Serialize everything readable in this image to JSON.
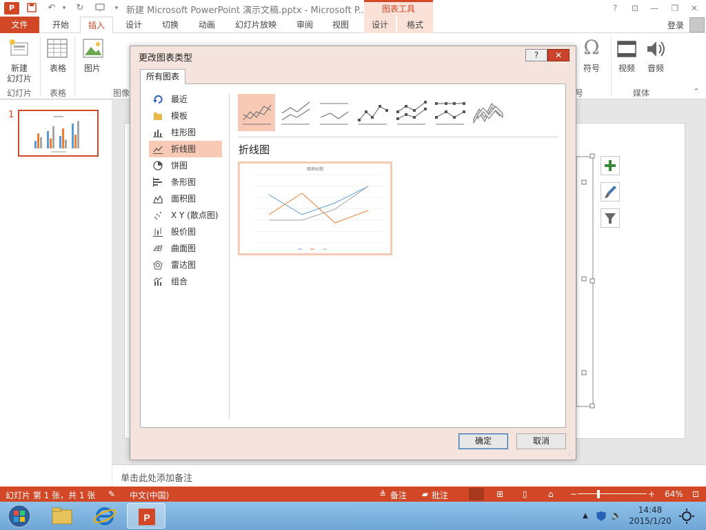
{
  "window": {
    "title": "新建 Microsoft PowerPoint 演示文稿.pptx - Microsoft P...",
    "app_icon": "P",
    "context_tools": "图表工具",
    "help": "?",
    "ribbon_display": "⊡",
    "minimize": "—",
    "restore": "❐",
    "close": "✕"
  },
  "tabs": [
    {
      "label": "文件"
    },
    {
      "label": "开始"
    },
    {
      "label": "插入"
    },
    {
      "label": "设计"
    },
    {
      "label": "切换"
    },
    {
      "label": "动画"
    },
    {
      "label": "幻灯片放映"
    },
    {
      "label": "审阅"
    },
    {
      "label": "视图"
    },
    {
      "label": "设计"
    },
    {
      "label": "格式"
    }
  ],
  "signin": "登录",
  "ribbon": {
    "new_slide": "新建",
    "new_slide_2": "幻灯片",
    "table": "表格",
    "picture": "图片",
    "symbol": "符号",
    "video": "视频",
    "audio": "音频",
    "groups": {
      "slides": "幻灯片",
      "tables": "表格",
      "images": "图像",
      "symbols": "号",
      "media": "媒体"
    }
  },
  "thumbnail": {
    "number": "1"
  },
  "notes_placeholder": "单击此处添加备注",
  "status": {
    "slide_info": "幻灯片 第 1 张，共 1 张",
    "language": "中文(中国)",
    "notes": "备注",
    "comments": "批注",
    "zoom": "64%"
  },
  "taskbar": {
    "time": "14:48",
    "date": "2015/1/20"
  },
  "dialog": {
    "title": "更改图表类型",
    "help": "?",
    "close": "✕",
    "tab": "所有图表",
    "categories": [
      {
        "label": "最近"
      },
      {
        "label": "模板"
      },
      {
        "label": "柱形图"
      },
      {
        "label": "折线图"
      },
      {
        "label": "饼图"
      },
      {
        "label": "条形图"
      },
      {
        "label": "面积图"
      },
      {
        "label": "X Y (散点图)"
      },
      {
        "label": "股价图"
      },
      {
        "label": "曲面图"
      },
      {
        "label": "雷达图"
      },
      {
        "label": "组合"
      }
    ],
    "selected_category": "折线图",
    "subtype_title": "折线图",
    "preview_title": "图表标题",
    "ok": "确定",
    "cancel": "取消"
  },
  "colors": {
    "accent": "#d24726",
    "selection": "#f8c9b4",
    "series1": "#5b9bd5",
    "series2": "#ed7d31",
    "series3": "#a5a5a5"
  }
}
